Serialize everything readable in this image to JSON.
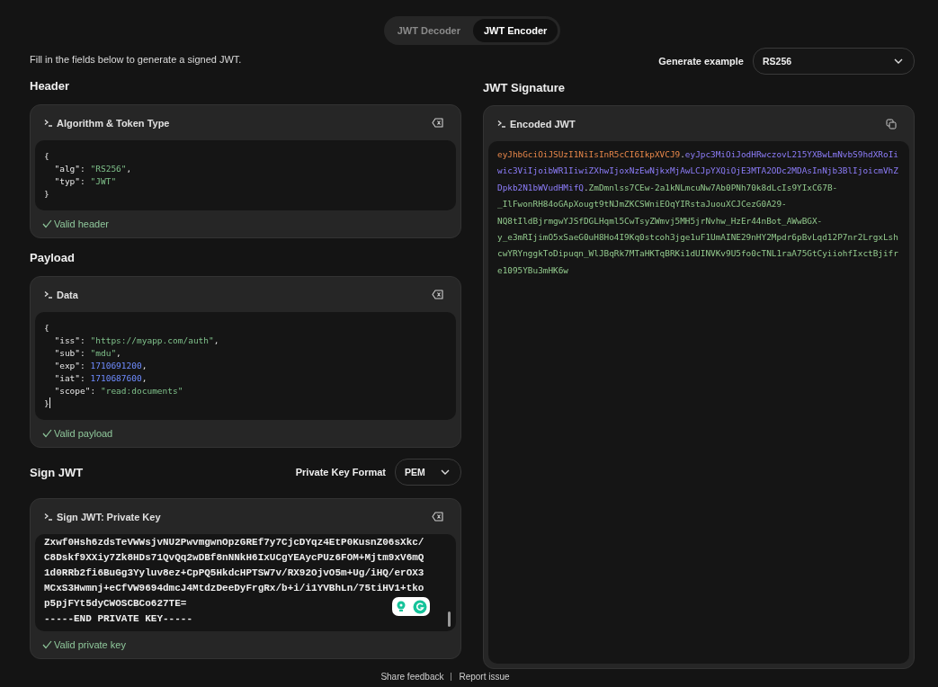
{
  "mode_tabs": [
    {
      "label": "JWT Decoder",
      "selected": false
    },
    {
      "label": "JWT Encoder",
      "selected": true
    }
  ],
  "intro": "Fill in the fields below to generate a signed JWT.",
  "generate_example": {
    "label": "Generate example",
    "value": "RS256"
  },
  "header": {
    "heading": "Header",
    "panel": {
      "title": "Algorithm & Token Type",
      "valid": true,
      "status": "Valid header",
      "lines": [
        [
          {
            "kind": "punct",
            "text": "{"
          }
        ],
        [
          {
            "kind": "key",
            "text": "  \"alg\""
          },
          {
            "kind": "punct",
            "text": ": "
          },
          {
            "kind": "string",
            "text": "\"RS256\""
          },
          {
            "kind": "punct",
            "text": ","
          }
        ],
        [
          {
            "kind": "key",
            "text": "  \"typ\""
          },
          {
            "kind": "punct",
            "text": ": "
          },
          {
            "kind": "string",
            "text": "\"JWT\""
          }
        ],
        [
          {
            "kind": "punct",
            "text": "}"
          }
        ]
      ]
    }
  },
  "payload": {
    "heading": "Payload",
    "panel": {
      "title": "Data",
      "valid": true,
      "status": "Valid payload",
      "lines": [
        [
          {
            "kind": "punct",
            "text": "{"
          }
        ],
        [
          {
            "kind": "key",
            "text": "  \"iss\""
          },
          {
            "kind": "punct",
            "text": ": "
          },
          {
            "kind": "string",
            "text": "\"https://myapp.com/auth\""
          },
          {
            "kind": "punct",
            "text": ","
          }
        ],
        [
          {
            "kind": "key",
            "text": "  \"sub\""
          },
          {
            "kind": "punct",
            "text": ": "
          },
          {
            "kind": "string",
            "text": "\"mdu\""
          },
          {
            "kind": "punct",
            "text": ","
          }
        ],
        [
          {
            "kind": "key",
            "text": "  \"exp\""
          },
          {
            "kind": "punct",
            "text": ": "
          },
          {
            "kind": "number",
            "text": "1710691200"
          },
          {
            "kind": "punct",
            "text": ","
          }
        ],
        [
          {
            "kind": "key",
            "text": "  \"iat\""
          },
          {
            "kind": "punct",
            "text": ": "
          },
          {
            "kind": "number",
            "text": "1710687600"
          },
          {
            "kind": "punct",
            "text": ","
          }
        ],
        [
          {
            "kind": "key",
            "text": "  \"scope\""
          },
          {
            "kind": "punct",
            "text": ": "
          },
          {
            "kind": "string",
            "text": "\"read:documents\""
          }
        ],
        [
          {
            "kind": "punct",
            "text": "}"
          },
          {
            "kind": "cursor"
          }
        ]
      ]
    }
  },
  "sign": {
    "heading": "Sign JWT",
    "format": {
      "label": "Private Key Format",
      "value": "PEM"
    },
    "panel": {
      "title": "Sign JWT: Private Key",
      "valid": true,
      "status": "Valid private key",
      "lines": [
        "Zxwf0Hsh6zdsTeVWWsjvNU2PwvmgwnOpzGREf7y7CjcDYqz4EtP0KusnZ06sXkc/",
        "C8Dskf9XXiy7Zk8HDs71QvQq2wDBf8nNNkH6IxUCgYEAycPUz6FOM+Mjtm9xV6mQ",
        "1d0RRb2fi6BuGg3Yyluv8ez+CpPQ5HkdcHPTSW7v/RX92OjvO5m+Ug/iHQ/erOX3",
        "MCxS3Hwmnj+eCfVW9694dmcJ4MtdzDeeDyFrgRx/b+i/i1YVBhLn/75tiHV1+tko",
        "p5pjFYt5dyCWOSCBCo627TE=",
        "-----END PRIVATE KEY-----"
      ]
    }
  },
  "signature": {
    "heading": "JWT Signature",
    "panel": {
      "title": "Encoded JWT",
      "parts": [
        {
          "kind": "header",
          "text": "eyJhbGciOiJSUzI1NiIsInR5cCI6IkpXVCJ9"
        },
        {
          "kind": "separator",
          "text": "."
        },
        {
          "kind": "payload",
          "text": "eyJpc3MiOiJodHRwczovL215YXBwLmNvbS9hdXRoIiwic3ViIjoibWR1IiwiZXhwIjoxNzEwNjkxMjAwLCJpYXQiOjE3MTA2ODc2MDAsInNjb3BlIjoicmVhZDpkb2N1bWVudHMifQ"
        },
        {
          "kind": "separator",
          "text": "."
        },
        {
          "kind": "signature",
          "text": "ZmDmnlss7CEw-2a1kNLmcuNw7Ab0PNh70k8dLcIs9YIxC67B-_IlFwonRH84oGApXougt9tNJmZKCSWniEOqYIRstaJuouXCJCezG0A29-NQ8tIldBjrmgwYJSfDGLHqml5CwTsyZWmvj5MH5jrNvhw_HzEr44nBot_AWwBGX-y_e3mRIjimO5xSaeG0uH8Ho4I9Kq0stcoh3jge1uF1UmAINE29nHY2Mpdr6pBvLqd12P7nr2LrgxLshcwYRYnggkToDipuqn_WlJBqRk7MTaHKTqBRKi1dUINVKv9U5fo0cTNL1raA75GtCyiiohfIxctBjifre1095YBu3mHK6w"
        }
      ]
    }
  },
  "footer_links": [
    "Share feedback",
    "Report issue"
  ]
}
